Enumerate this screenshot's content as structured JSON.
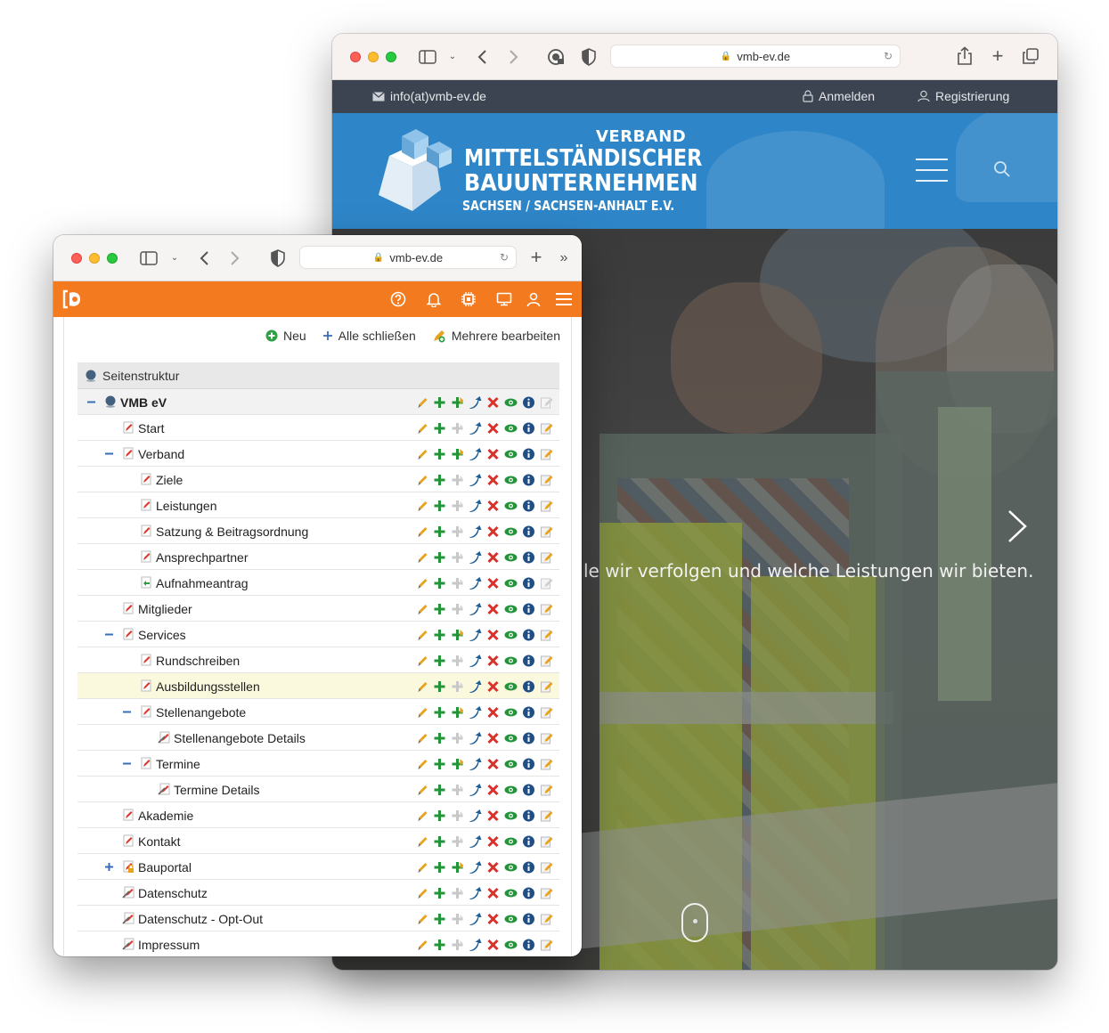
{
  "back_browser": {
    "url": "vmb-ev.de",
    "topbar": {
      "email": "info(at)vmb-ev.de",
      "login": "Anmelden",
      "register": "Registrierung"
    },
    "logo": {
      "line1": "VERBAND",
      "line2": "MITTELSTÄNDISCHER",
      "line3": "BAUUNTERNEHMEN",
      "line4": "SACHSEN / SACHSEN-ANHALT E.V."
    },
    "hero_text": "le wir verfolgen und welche Leistungen wir bieten."
  },
  "front_browser": {
    "url": "vmb-ev.de",
    "actions": {
      "new": "Neu",
      "collapse_all": "Alle schließen",
      "edit_multiple": "Mehrere bearbeiten"
    },
    "tree_header": "Seitenstruktur",
    "tree": [
      {
        "label": "VMB eV",
        "level": 0,
        "toggle": "minus",
        "icon": "globe",
        "root": true,
        "sub": true
      },
      {
        "label": "Start",
        "level": 1,
        "toggle": "",
        "icon": "page",
        "sub": false
      },
      {
        "label": "Verband",
        "level": 1,
        "toggle": "minus",
        "icon": "page",
        "sub": true
      },
      {
        "label": "Ziele",
        "level": 2,
        "toggle": "",
        "icon": "page",
        "sub": false
      },
      {
        "label": "Leistungen",
        "level": 2,
        "toggle": "",
        "icon": "page",
        "sub": false
      },
      {
        "label": "Satzung & Beitragsordnung",
        "level": 2,
        "toggle": "",
        "icon": "page",
        "sub": false
      },
      {
        "label": "Ansprechpartner",
        "level": 2,
        "toggle": "",
        "icon": "page",
        "sub": false
      },
      {
        "label": "Aufnahmeantrag",
        "level": 2,
        "toggle": "",
        "icon": "form",
        "sub": false
      },
      {
        "label": "Mitglieder",
        "level": 1,
        "toggle": "",
        "icon": "page",
        "sub": false
      },
      {
        "label": "Services",
        "level": 1,
        "toggle": "minus",
        "icon": "page",
        "sub": true
      },
      {
        "label": "Rundschreiben",
        "level": 2,
        "toggle": "",
        "icon": "page",
        "sub": false
      },
      {
        "label": "Ausbildungsstellen",
        "level": 2,
        "toggle": "",
        "icon": "page",
        "sub": false,
        "highlight": true
      },
      {
        "label": "Stellenangebote",
        "level": 2,
        "toggle": "minus",
        "icon": "page",
        "sub": true
      },
      {
        "label": "Stellenangebote Details",
        "level": 3,
        "toggle": "",
        "icon": "hidden-page",
        "sub": false
      },
      {
        "label": "Termine",
        "level": 2,
        "toggle": "minus",
        "icon": "page",
        "sub": true
      },
      {
        "label": "Termine Details",
        "level": 3,
        "toggle": "",
        "icon": "hidden-page",
        "sub": false
      },
      {
        "label": "Akademie",
        "level": 1,
        "toggle": "",
        "icon": "page",
        "sub": false
      },
      {
        "label": "Kontakt",
        "level": 1,
        "toggle": "",
        "icon": "page",
        "sub": false
      },
      {
        "label": "Bauportal",
        "level": 1,
        "toggle": "plus",
        "icon": "protected-page",
        "sub": true
      },
      {
        "label": "Datenschutz",
        "level": 1,
        "toggle": "",
        "icon": "hidden-page",
        "sub": false
      },
      {
        "label": "Datenschutz - Opt-Out",
        "level": 1,
        "toggle": "",
        "icon": "hidden-page",
        "sub": false
      },
      {
        "label": "Impressum",
        "level": 1,
        "toggle": "",
        "icon": "hidden-page",
        "sub": false
      }
    ]
  },
  "colors": {
    "cms_orange": "#f47a1f",
    "site_blue": "#2e86c8",
    "site_topbar": "#3b4450",
    "highlight_row": "#fbf9dd"
  }
}
